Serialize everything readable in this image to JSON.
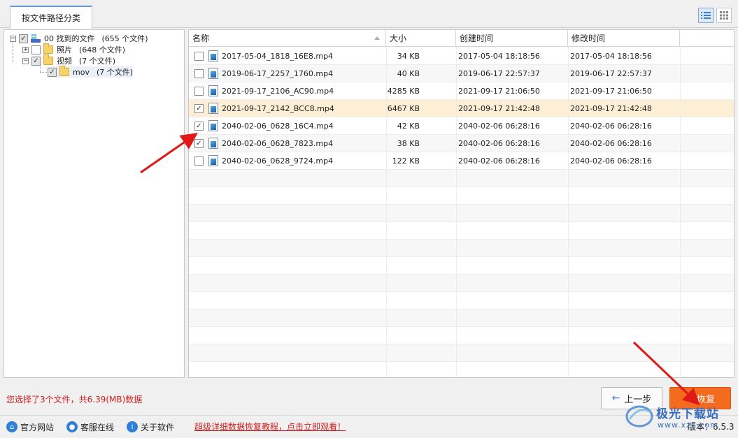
{
  "tab": {
    "label": "按文件路径分类"
  },
  "tree": {
    "root": {
      "label": "00 找到的文件",
      "count": "(655 个文件)"
    },
    "photos": {
      "label": "照片",
      "count": "(648 个文件)"
    },
    "videos": {
      "label": "视频",
      "count": "(7 个文件)"
    },
    "mov": {
      "label": "mov",
      "count": "(7 个文件)"
    }
  },
  "columns": {
    "name": "名称",
    "size": "大小",
    "created": "创建时间",
    "modified": "修改时间"
  },
  "files": [
    {
      "name": "2017-05-04_1818_16E8.mp4",
      "size": "34 KB",
      "created": "2017-05-04  18:18:56",
      "modified": "2017-05-04  18:18:56",
      "checked": false
    },
    {
      "name": "2019-06-17_2257_1760.mp4",
      "size": "40 KB",
      "created": "2019-06-17  22:57:37",
      "modified": "2019-06-17  22:57:37",
      "checked": false
    },
    {
      "name": "2021-09-17_2106_AC90.mp4",
      "size": "4285 KB",
      "created": "2021-09-17  21:06:50",
      "modified": "2021-09-17  21:06:50",
      "checked": false
    },
    {
      "name": "2021-09-17_2142_BCC8.mp4",
      "size": "6467 KB",
      "created": "2021-09-17  21:42:48",
      "modified": "2021-09-17  21:42:48",
      "checked": true
    },
    {
      "name": "2040-02-06_0628_16C4.mp4",
      "size": "42 KB",
      "created": "2040-02-06  06:28:16",
      "modified": "2040-02-06  06:28:16",
      "checked": true
    },
    {
      "name": "2040-02-06_0628_7823.mp4",
      "size": "38 KB",
      "created": "2040-02-06  06:28:16",
      "modified": "2040-02-06  06:28:16",
      "checked": true
    },
    {
      "name": "2040-02-06_0628_9724.mp4",
      "size": "122 KB",
      "created": "2040-02-06  06:28:16",
      "modified": "2040-02-06  06:28:16",
      "checked": false
    }
  ],
  "status": {
    "text": "您选择了3个文件，共6.39(MB)数据"
  },
  "buttons": {
    "prev": "上一步",
    "recover": "恢复"
  },
  "footer": {
    "website": "官方网站",
    "support": "客服在线",
    "about": "关于软件",
    "promo": "超级详细数据恢复教程，点击立即观看！",
    "version": "版本：6.5.3"
  },
  "watermark": {
    "text": "极光下载站",
    "url": "www.xz7.com"
  },
  "colors": {
    "accent": "#f46a1e",
    "selected_row": "#fdefd6",
    "status_red": "#d21e1e",
    "link_blue": "#2f7fd6"
  }
}
